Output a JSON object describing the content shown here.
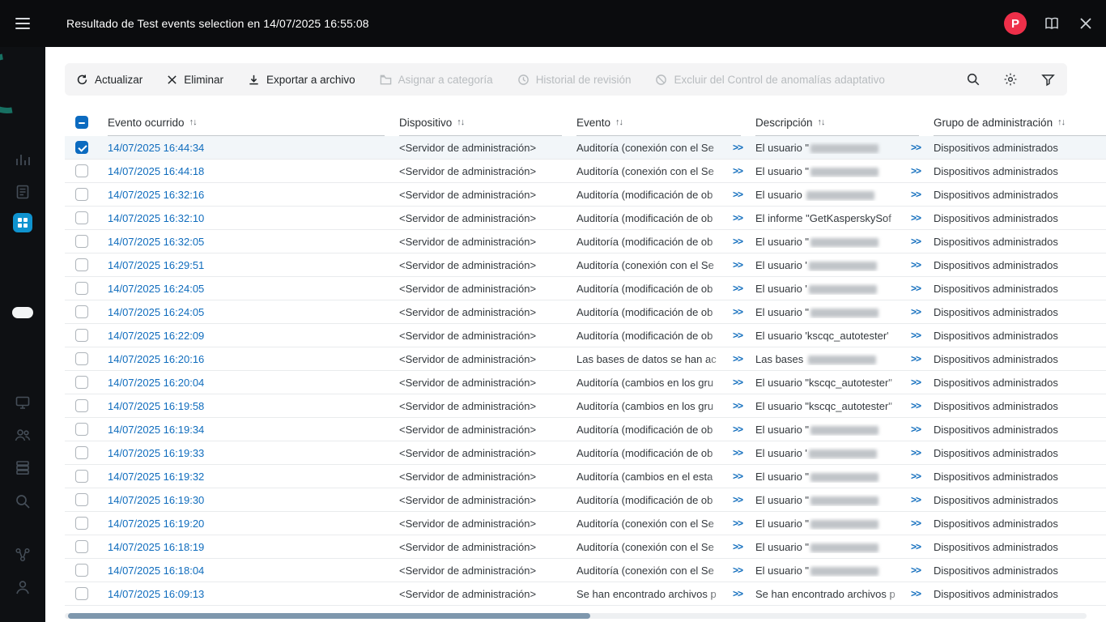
{
  "topbar": {
    "title": "Resultado de Test events selection en 14/07/2025 16:55:08",
    "badge_glyph": "P",
    "icons": [
      "bug-report-badge",
      "documentation-icon",
      "close-icon"
    ]
  },
  "sidebar": {
    "icons": [
      "hamburger-menu-icon",
      "monitoring-icon",
      "reports-icon",
      "assets-icon-active",
      "nav-indicator",
      "devices-icon",
      "users-icon",
      "storage-icon",
      "search-icon",
      "operations-icon",
      "account-icon"
    ]
  },
  "toolbar": {
    "buttons": [
      {
        "label": "Actualizar",
        "enabled": true,
        "icon": "refresh-icon"
      },
      {
        "label": "Eliminar",
        "enabled": true,
        "icon": "delete-icon"
      },
      {
        "label": "Exportar a archivo",
        "enabled": true,
        "icon": "export-icon"
      },
      {
        "label": "Asignar a categoría",
        "enabled": false,
        "icon": "assign-category-icon"
      },
      {
        "label": "Historial de revisión",
        "enabled": false,
        "icon": "revision-history-icon"
      },
      {
        "label": "Excluir del Control de anomalías adaptativo",
        "enabled": false,
        "icon": "exclude-anomaly-icon"
      }
    ],
    "right_icons": [
      "search-icon",
      "settings-icon",
      "filter-icon"
    ]
  },
  "table": {
    "expand_label": ">>",
    "sort_glyph": "↑↓",
    "header_checkbox_state": "indeterminate",
    "columns": [
      {
        "key": "select",
        "label": ""
      },
      {
        "key": "occurred",
        "label": "Evento ocurrido",
        "sortable": true
      },
      {
        "key": "device",
        "label": "Dispositivo",
        "sortable": true
      },
      {
        "key": "event",
        "label": "Evento",
        "sortable": true
      },
      {
        "key": "description",
        "label": "Descripción",
        "sortable": true
      },
      {
        "key": "group",
        "label": "Grupo de administración",
        "sortable": true
      }
    ],
    "rows": [
      {
        "time": "14/07/2025 16:44:34",
        "device": "<Servidor de administración>",
        "event": "Auditoría (conexión con el Se",
        "desc_pre": "El usuario \"",
        "desc_redacted": true,
        "group": "Dispositivos administrados",
        "checked": true
      },
      {
        "time": "14/07/2025 16:44:18",
        "device": "<Servidor de administración>",
        "event": "Auditoría (conexión con el Se",
        "desc_pre": "El usuario \"",
        "desc_redacted": true,
        "group": "Dispositivos administrados",
        "checked": false
      },
      {
        "time": "14/07/2025 16:32:16",
        "device": "<Servidor de administración>",
        "event": "Auditoría (modificación de ob",
        "desc_pre": "El usuario ",
        "desc_redacted": true,
        "group": "Dispositivos administrados",
        "checked": false
      },
      {
        "time": "14/07/2025 16:32:10",
        "device": "<Servidor de administración>",
        "event": "Auditoría (modificación de ob",
        "desc_pre": "El informe \"GetKasperskySof",
        "desc_redacted": false,
        "group": "Dispositivos administrados",
        "checked": false
      },
      {
        "time": "14/07/2025 16:32:05",
        "device": "<Servidor de administración>",
        "event": "Auditoría (modificación de ob",
        "desc_pre": "El usuario \"",
        "desc_redacted": true,
        "group": "Dispositivos administrados",
        "checked": false
      },
      {
        "time": "14/07/2025 16:29:51",
        "device": "<Servidor de administración>",
        "event": "Auditoría (conexión con el Se",
        "desc_pre": "El usuario '",
        "desc_redacted": true,
        "group": "Dispositivos administrados",
        "checked": false
      },
      {
        "time": "14/07/2025 16:24:05",
        "device": "<Servidor de administración>",
        "event": "Auditoría (modificación de ob",
        "desc_pre": "El usuario '",
        "desc_redacted": true,
        "group": "Dispositivos administrados",
        "checked": false
      },
      {
        "time": "14/07/2025 16:24:05",
        "device": "<Servidor de administración>",
        "event": "Auditoría (modificación de ob",
        "desc_pre": "El usuario \"",
        "desc_redacted": true,
        "group": "Dispositivos administrados",
        "checked": false
      },
      {
        "time": "14/07/2025 16:22:09",
        "device": "<Servidor de administración>",
        "event": "Auditoría (modificación de ob",
        "desc_pre": "El usuario 'kscqc_autotester' ",
        "desc_redacted": false,
        "group": "Dispositivos administrados",
        "checked": false
      },
      {
        "time": "14/07/2025 16:20:16",
        "device": "<Servidor de administración>",
        "event": "Las bases de datos se han ac",
        "desc_pre": "Las bases ",
        "desc_redacted": true,
        "group": "Dispositivos administrados",
        "checked": false
      },
      {
        "time": "14/07/2025 16:20:04",
        "device": "<Servidor de administración>",
        "event": "Auditoría (cambios en los gru",
        "desc_pre": "El usuario \"kscqc_autotester\"",
        "desc_redacted": false,
        "group": "Dispositivos administrados",
        "checked": false
      },
      {
        "time": "14/07/2025 16:19:58",
        "device": "<Servidor de administración>",
        "event": "Auditoría (cambios en los gru",
        "desc_pre": "El usuario \"kscqc_autotester\"",
        "desc_redacted": false,
        "group": "Dispositivos administrados",
        "checked": false
      },
      {
        "time": "14/07/2025 16:19:34",
        "device": "<Servidor de administración>",
        "event": "Auditoría (modificación de ob",
        "desc_pre": "El usuario \"",
        "desc_redacted": true,
        "group": "Dispositivos administrados",
        "checked": false
      },
      {
        "time": "14/07/2025 16:19:33",
        "device": "<Servidor de administración>",
        "event": "Auditoría (modificación de ob",
        "desc_pre": "El usuario '",
        "desc_redacted": true,
        "group": "Dispositivos administrados",
        "checked": false
      },
      {
        "time": "14/07/2025 16:19:32",
        "device": "<Servidor de administración>",
        "event": "Auditoría (cambios en el esta",
        "desc_pre": "El usuario \"",
        "desc_redacted": true,
        "group": "Dispositivos administrados",
        "checked": false
      },
      {
        "time": "14/07/2025 16:19:30",
        "device": "<Servidor de administración>",
        "event": "Auditoría (modificación de ob",
        "desc_pre": "El usuario \"",
        "desc_redacted": true,
        "group": "Dispositivos administrados",
        "checked": false
      },
      {
        "time": "14/07/2025 16:19:20",
        "device": "<Servidor de administración>",
        "event": "Auditoría (conexión con el Se",
        "desc_pre": "El usuario \"",
        "desc_redacted": true,
        "group": "Dispositivos administrados",
        "checked": false
      },
      {
        "time": "14/07/2025 16:18:19",
        "device": "<Servidor de administración>",
        "event": "Auditoría (conexión con el Se",
        "desc_pre": "El usuario \"",
        "desc_redacted": true,
        "group": "Dispositivos administrados",
        "checked": false
      },
      {
        "time": "14/07/2025 16:18:04",
        "device": "<Servidor de administración>",
        "event": "Auditoría (conexión con el Se",
        "desc_pre": "El usuario \"",
        "desc_redacted": true,
        "group": "Dispositivos administrados",
        "checked": false
      },
      {
        "time": "14/07/2025 16:09:13",
        "device": "<Servidor de administración>",
        "event": "Se han encontrado archivos p",
        "desc_pre": "Se han encontrado archivos p",
        "desc_redacted": false,
        "group": "Dispositivos administrados",
        "checked": false
      }
    ]
  },
  "colors": {
    "accent_blue": "#0c6bc0",
    "link_blue": "#0f6cbd",
    "badge_red": "#ee2f49",
    "active_nav_blue": "#0f93cf",
    "dark_bg": "#0e1013"
  }
}
